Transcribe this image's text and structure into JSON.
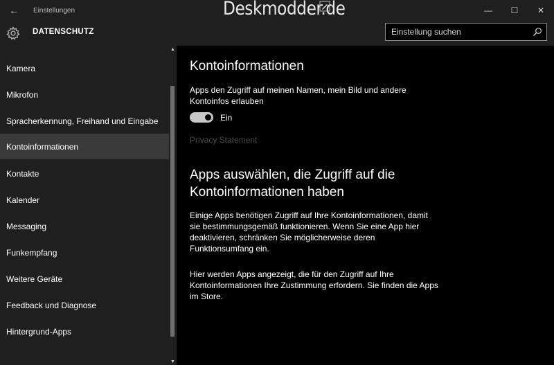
{
  "window": {
    "title": "Einstellungen",
    "back_glyph": "←",
    "watermark": "Deskmodder.de",
    "controls": {
      "minimize": "—",
      "maximize": "☐",
      "close": "✕"
    }
  },
  "header": {
    "title": "DATENSCHUTZ",
    "search_placeholder": "Einstellung suchen"
  },
  "sidebar": {
    "items": [
      {
        "label": "Kamera",
        "selected": false
      },
      {
        "label": "Mikrofon",
        "selected": false
      },
      {
        "label": "Spracherkennung, Freihand und Eingabe",
        "selected": false
      },
      {
        "label": "Kontoinformationen",
        "selected": true
      },
      {
        "label": "Kontakte",
        "selected": false
      },
      {
        "label": "Kalender",
        "selected": false
      },
      {
        "label": "Messaging",
        "selected": false
      },
      {
        "label": "Funkempfang",
        "selected": false
      },
      {
        "label": "Weitere Geräte",
        "selected": false
      },
      {
        "label": "Feedback und Diagnose",
        "selected": false
      },
      {
        "label": "Hintergrund-Apps",
        "selected": false
      }
    ]
  },
  "main": {
    "heading": "Kontoinformationen",
    "setting_description": "Apps den Zugriff auf meinen Namen, mein Bild und andere Kontoinfos erlauben",
    "toggle": {
      "state": "on",
      "label": "Ein"
    },
    "privacy_link": "Privacy Statement",
    "section_heading": "Apps auswählen, die Zugriff auf die Kontoinformationen haben",
    "paragraph1": "Einige Apps benötigen Zugriff auf Ihre Kontoinformationen, damit sie bestimmungsgemäß funktionieren. Wenn Sie eine App hier deaktivieren, schränken Sie möglicherweise deren Funktionsumfang ein.",
    "paragraph2": "Hier werden Apps angezeigt, die für den Zugriff auf Ihre Kontoinformationen Ihre Zustimmung erfordern. Sie finden die Apps im Store."
  },
  "colors": {
    "chrome": "#1f1f1f",
    "content_bg": "#000000",
    "selected_item": "#3a3a3a",
    "link_disabled": "#4a4a4a"
  }
}
